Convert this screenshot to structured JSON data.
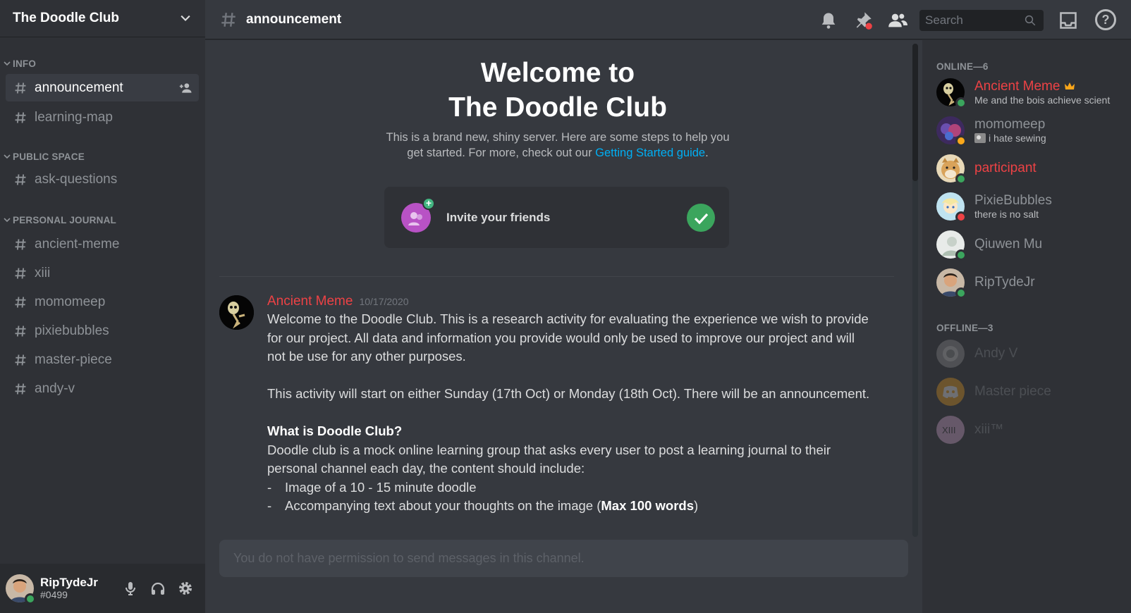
{
  "server": {
    "name": "The Doodle Club"
  },
  "sidebar": {
    "categories": [
      {
        "label": "INFO",
        "channels": [
          "announcement",
          "learning-map"
        ]
      },
      {
        "label": "PUBLIC SPACE",
        "channels": [
          "ask-questions"
        ]
      },
      {
        "label": "PERSONAL JOURNAL",
        "channels": [
          "ancient-meme",
          "xiii",
          "momomeep",
          "pixiebubbles",
          "master-piece",
          "andy-v"
        ]
      }
    ]
  },
  "user": {
    "name": "RipTydeJr",
    "tag": "#0499"
  },
  "topbar": {
    "channel": "announcement",
    "search_placeholder": "Search"
  },
  "welcome": {
    "title_line1": "Welcome to",
    "title_line2": "The Doodle Club",
    "sub_line1": "This is a brand new, shiny server. Here are some steps to help you",
    "sub_line2_pre": "get started. For more, check out our ",
    "guide_link": "Getting Started guide",
    "sub_line2_post": ".",
    "invite_label": "Invite your friends"
  },
  "message": {
    "author": "Ancient Meme",
    "timestamp": "10/17/2020",
    "p1": "Welcome to the Doodle Club. This is a research activity for evaluating the experience we wish to provide for our project. All data and information you provide would only be used to improve our project and will not be use for any other purposes.",
    "p2": "This activity will start on either Sunday (17th Oct) or Monday (18th Oct). There will be an announcement.",
    "heading": "What is Doodle Club?",
    "p3": "Doodle club is a mock online learning group that asks every user to post a learning journal to their personal channel each day, the content should include:",
    "bullet1": "Image of a 10 - 15 minute doodle",
    "bullet2_pre": "Accompanying text about your thoughts on the image (",
    "bullet2_bold": "Max 100 words",
    "bullet2_post": ")",
    "dash": "-"
  },
  "composer": {
    "placeholder": "You do not have permission to send messages in this channel."
  },
  "members": {
    "online_label": "ONLINE—6",
    "offline_label": "OFFLINE—3",
    "online": [
      {
        "name": "Ancient Meme",
        "status": "Me and the bois achieve scient"
      },
      {
        "name": "momomeep",
        "status": "i hate sewing"
      },
      {
        "name": "participant",
        "status": ""
      },
      {
        "name": "PixieBubbles",
        "status": "there is no salt"
      },
      {
        "name": "Qiuwen Mu",
        "status": ""
      },
      {
        "name": "RipTydeJr",
        "status": ""
      }
    ],
    "offline": [
      {
        "name": "Andy V"
      },
      {
        "name": "Master piece"
      },
      {
        "name": "xiii™"
      }
    ]
  },
  "colors": {
    "accent_red": "#ed4245",
    "link": "#00aff4",
    "online": "#3ba55d",
    "dnd": "#ed4245",
    "idle": "#faa81a"
  }
}
